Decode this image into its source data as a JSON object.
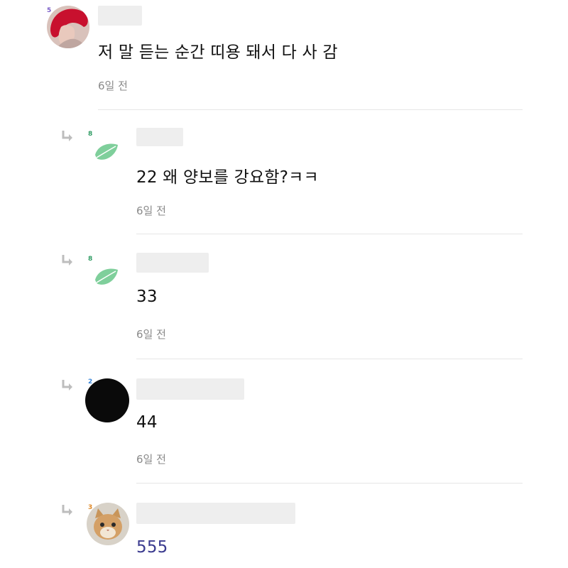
{
  "comments": [
    {
      "text": "저 말 듣는 순간 띠용 돼서 다 사 감",
      "time": "6일 전",
      "badge": "5",
      "badge_color": "#7a5cc7"
    },
    {
      "text": "22 왜 양보를 강요함?ㅋㅋ",
      "time": "6일 전",
      "badge": "8",
      "badge_color": "#2f9b63"
    },
    {
      "text": "33",
      "time": "6일 전",
      "badge": "8",
      "badge_color": "#2f9b63"
    },
    {
      "text": "44",
      "time": "6일 전",
      "badge": "2",
      "badge_color": "#3a86d8"
    },
    {
      "text": "555",
      "time": "",
      "badge": "3",
      "badge_color": "#e08a2a"
    }
  ],
  "colors": {
    "text": "#111111",
    "time": "#8a8a8a",
    "divider": "#e6e6e6",
    "leaf_green": "#7fcf9b",
    "last_comment_text": "#3b3b8f"
  },
  "icons": [
    "reply-arrow-icon",
    "leaf-avatar-icon",
    "level-badge-icon"
  ]
}
